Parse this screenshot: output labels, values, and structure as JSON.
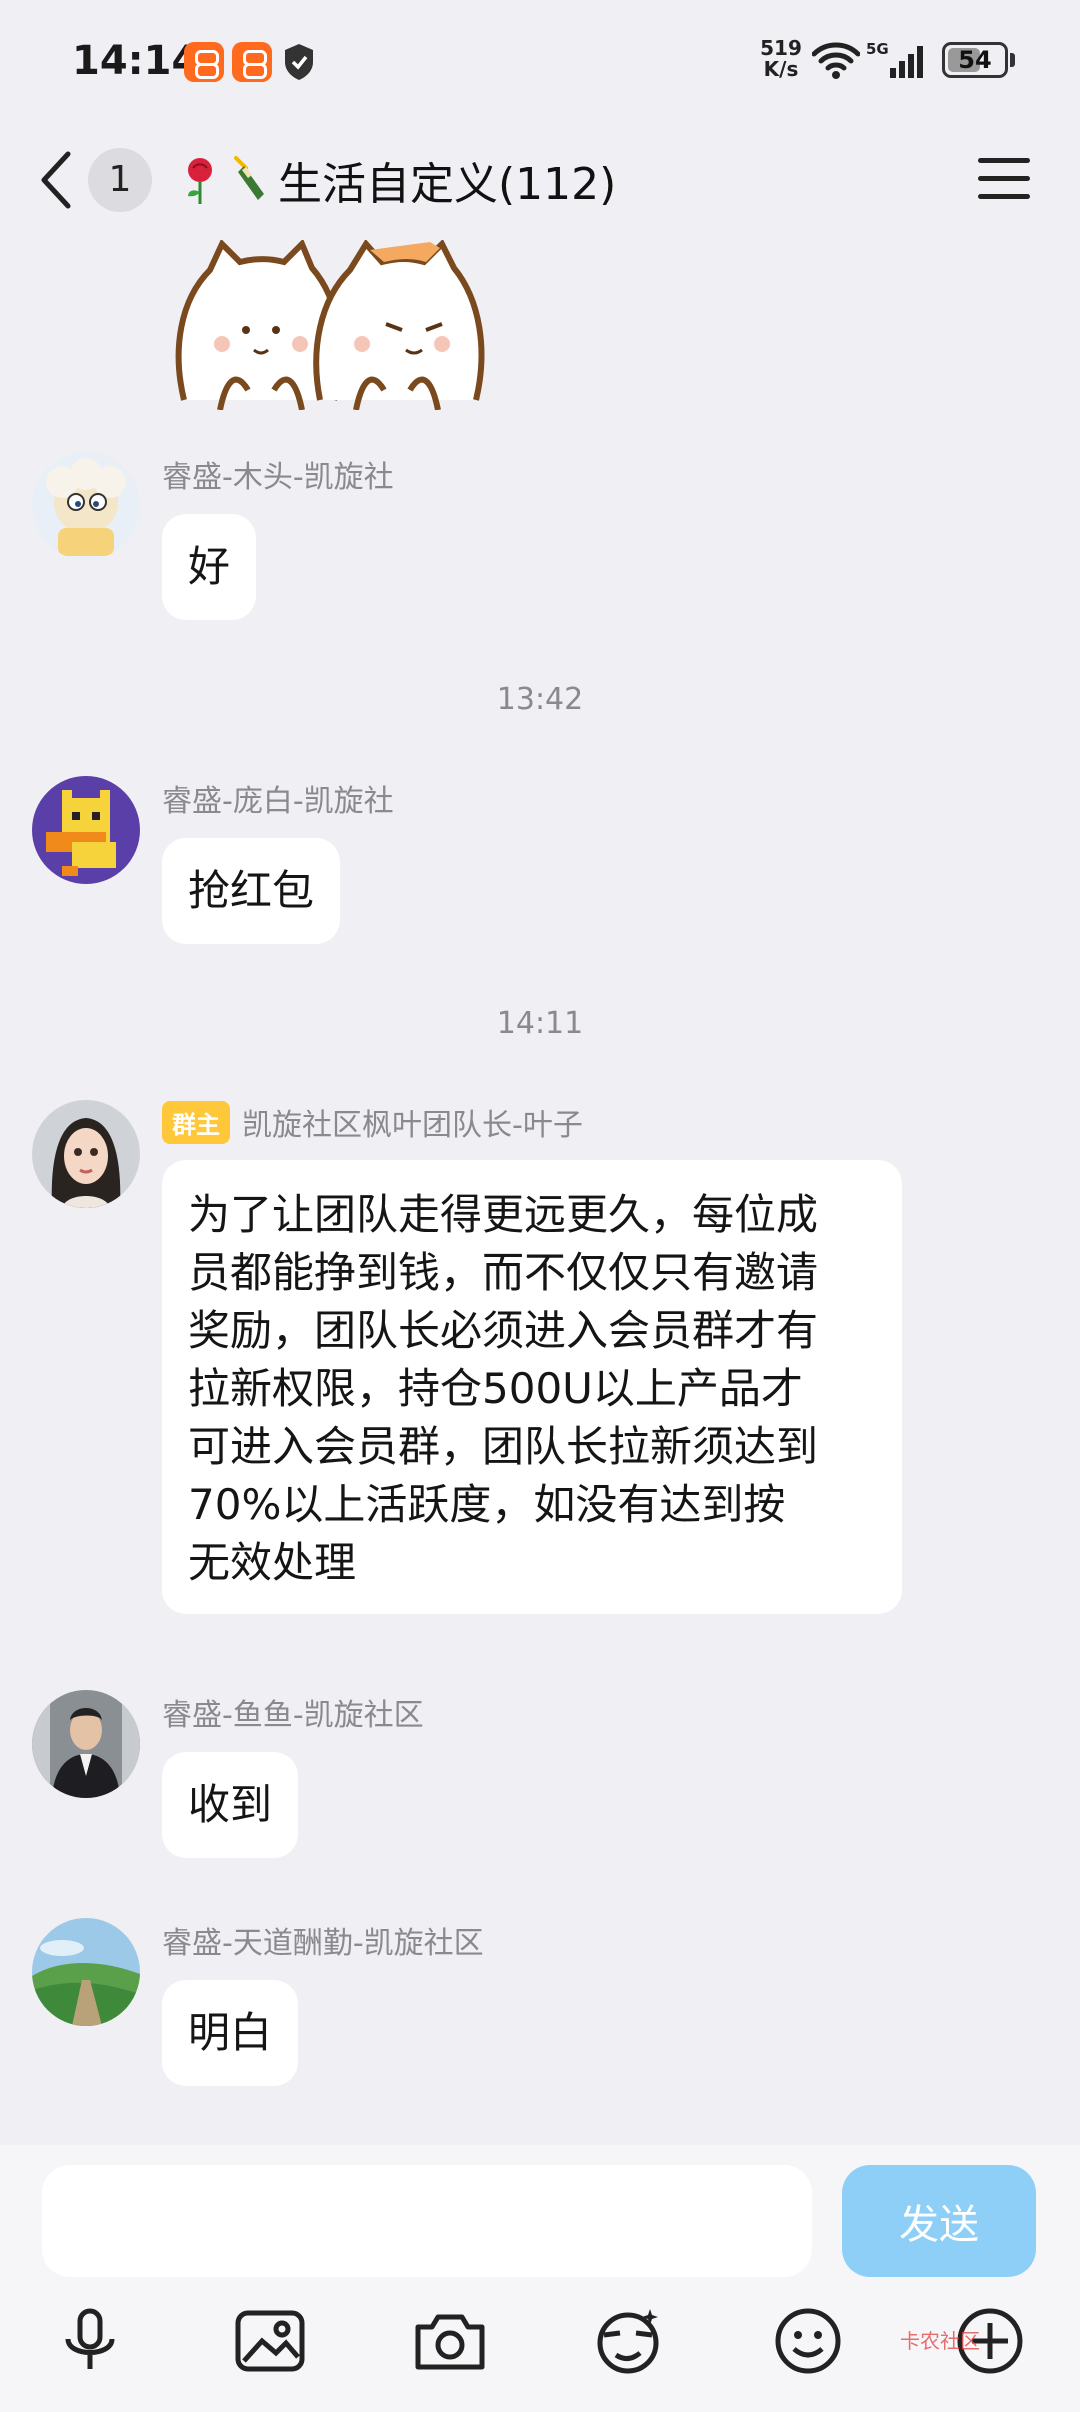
{
  "status_bar": {
    "time": "14:14",
    "net_speed_value": "519",
    "net_speed_unit": "K/s",
    "network": "5G",
    "battery": "54"
  },
  "nav": {
    "unread_count": "1",
    "title": "生活自定义(112)"
  },
  "messages": [
    {
      "sender": "睿盛-木头-凯旋社",
      "text": "好"
    },
    {
      "time": "13:42"
    },
    {
      "sender": "睿盛-庞白-凯旋社",
      "text": "抢红包"
    },
    {
      "time": "14:11"
    },
    {
      "role_tag": "群主",
      "sender": "凯旋社区枫叶团队长-叶子",
      "text_lines": [
        "为了让团队走得更远更久，每位成",
        "员都能挣到钱，而不仅仅只有邀请",
        "奖励，团队长必须进入会员群才有",
        "拉新权限，持仓500U以上产品才",
        "可进入会员群，团队长拉新须达到",
        "70%以上活跃度，如没有达到按",
        "无效处理"
      ]
    },
    {
      "sender": "睿盛-鱼鱼-凯旋社区",
      "text": "收到"
    },
    {
      "sender": "睿盛-天道酬勤-凯旋社区",
      "text": "明白"
    }
  ],
  "input": {
    "placeholder": "",
    "send_label": "发送"
  },
  "toolbar": [
    "microphone-icon",
    "image-icon",
    "camera-icon",
    "sticker-icon",
    "emoji-icon",
    "plus-icon"
  ],
  "watermark_text": "卡农社区",
  "colors": {
    "background": "#efeff4",
    "send_button": "#8ecff7",
    "owner_tag": "#ffc73a"
  }
}
